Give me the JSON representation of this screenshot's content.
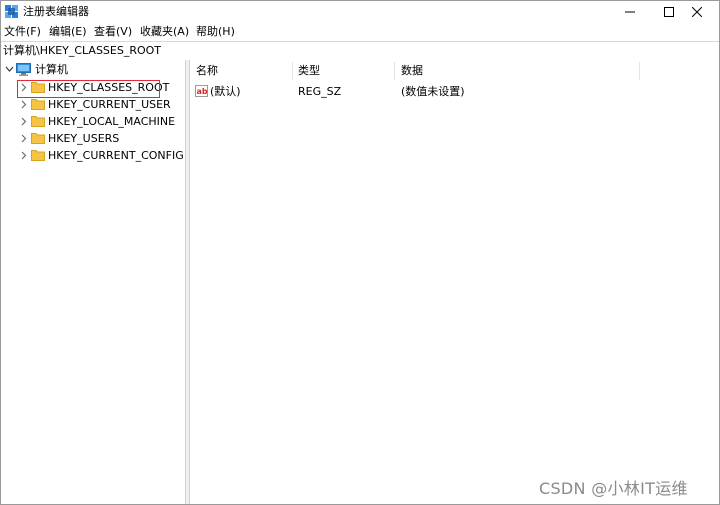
{
  "window": {
    "title": "注册表编辑器"
  },
  "menu": {
    "items": [
      "文件(F)",
      "编辑(E)",
      "查看(V)",
      "收藏夹(A)",
      "帮助(H)"
    ]
  },
  "address": {
    "path": "计算机\\HKEY_CLASSES_ROOT"
  },
  "tree": {
    "root_label": "计算机",
    "items": [
      {
        "label": "HKEY_CLASSES_ROOT",
        "selected": true
      },
      {
        "label": "HKEY_CURRENT_USER"
      },
      {
        "label": "HKEY_LOCAL_MACHINE"
      },
      {
        "label": "HKEY_USERS"
      },
      {
        "label": "HKEY_CURRENT_CONFIG"
      }
    ]
  },
  "list": {
    "columns": [
      "名称",
      "类型",
      "数据"
    ],
    "rows": [
      {
        "icon": "string-value-icon",
        "name": "(默认)",
        "type": "REG_SZ",
        "data": "(数值未设置)"
      }
    ]
  },
  "watermark": "CSDN @小林IT运维",
  "colors": {
    "highlight_border": "#e0283a",
    "folder": "#f5c445",
    "computer_icon": "#2b8fe0"
  }
}
